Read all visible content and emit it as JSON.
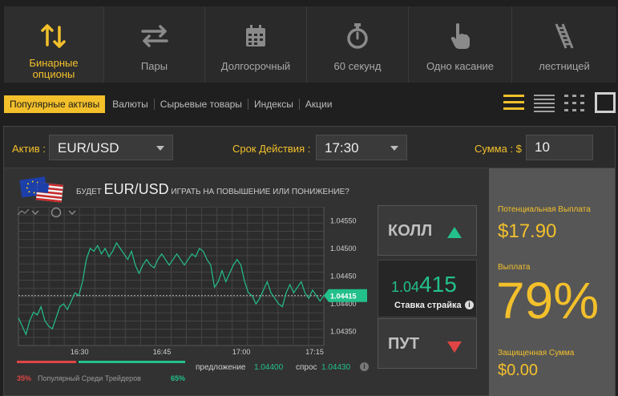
{
  "tabs": [
    {
      "label": "Бинарные\nопционы",
      "icon": "up-down-arrows-icon",
      "active": true
    },
    {
      "label": "Пары",
      "icon": "left-right-arrows-icon",
      "active": false
    },
    {
      "label": "Долгосрочный",
      "icon": "calendar-icon",
      "active": false
    },
    {
      "label": "60 секунд",
      "icon": "stopwatch-icon",
      "active": false
    },
    {
      "label": "Одно касание",
      "icon": "pointing-hand-icon",
      "active": false
    },
    {
      "label": "лестницей",
      "icon": "ladder-icon",
      "active": false
    }
  ],
  "categories": [
    {
      "label": "Популярные активы",
      "active": true
    },
    {
      "label": "Валюты",
      "active": false
    },
    {
      "label": "Сырьевые товары",
      "active": false
    },
    {
      "label": "Индексы",
      "active": false
    },
    {
      "label": "Акции",
      "active": false
    }
  ],
  "view_icons": [
    "list-lines-icon",
    "list-compact-icon",
    "grid-dots-icon",
    "single-square-icon"
  ],
  "form": {
    "asset_label": "Актив :",
    "asset_value": "EUR/USD",
    "expiry_label": "Срок Действия :",
    "expiry_value": "17:30",
    "amount_label": "Сумма : $",
    "amount_value": "10"
  },
  "question": {
    "prefix": "БУДЕТ",
    "pair": "EUR/USD",
    "suffix": "ИГРАТЬ НА ПОВЫШЕНИЕ ИЛИ ПОНИЖЕНИЕ?"
  },
  "chart_data": {
    "type": "line",
    "x_ticks": [
      "16:30",
      "16:45",
      "17:00",
      "17:15"
    ],
    "y_ticks": [
      "1.04550",
      "1.04500",
      "1.04450",
      "1.04400",
      "1.04350"
    ],
    "ylim": [
      1.04325,
      1.04575
    ],
    "current_label": "1.04415",
    "current_value": 1.04415,
    "x_minutes_range": [
      16.0,
      17.3
    ],
    "series": [
      {
        "values": [
          1.04375,
          1.0436,
          1.04345,
          1.0437,
          1.04385,
          1.0438,
          1.04395,
          1.0437,
          1.0436,
          1.04355,
          1.04375,
          1.04395,
          1.044,
          1.0439,
          1.04405,
          1.0442,
          1.04415,
          1.0444,
          1.0448,
          1.045,
          1.04495,
          1.04505,
          1.0449,
          1.045,
          1.04485,
          1.04495,
          1.0451,
          1.045,
          1.0449,
          1.0448,
          1.04495,
          1.0447,
          1.04455,
          1.0447,
          1.0448,
          1.0447,
          1.04465,
          1.0448,
          1.0449,
          1.0448,
          1.0447,
          1.0448,
          1.0449,
          1.0448,
          1.0447,
          1.0448,
          1.0449,
          1.04485,
          1.045,
          1.04495,
          1.0448,
          1.0447,
          1.0443,
          1.0444,
          1.0446,
          1.0444,
          1.04455,
          1.0447,
          1.0448,
          1.0447,
          1.0444,
          1.0442,
          1.04415,
          1.044,
          1.0441,
          1.04425,
          1.0444,
          1.0442,
          1.0441,
          1.044,
          1.04395,
          1.0442,
          1.04435,
          1.0442,
          1.0443,
          1.0444,
          1.0442,
          1.0441,
          1.04425,
          1.04415,
          1.04405,
          1.04415
        ]
      }
    ]
  },
  "popular": {
    "label": "Популярный Среди Трейдеров",
    "left_percent": "35%",
    "right_percent": "65%",
    "bid_label": "предложение",
    "bid_value": "1.04400",
    "ask_label": "спрос",
    "ask_value": "1.04430",
    "left_color": "#e04545",
    "right_color": "#23c08c"
  },
  "call_label": "КОЛЛ",
  "put_label": "ПУТ",
  "strike": {
    "price_small": "1.04",
    "price_big": "415",
    "label": "Ставка страйка"
  },
  "payout": {
    "potential_label": "Потенциальная Выплата",
    "potential_value": "$17.90",
    "payout_label": "Выплата",
    "payout_value": "79%",
    "protected_label": "Защищенная Сумма",
    "protected_value": "$0.00"
  },
  "colors": {
    "accent": "#f3c02b",
    "up": "#23c08c",
    "down": "#e04545"
  }
}
